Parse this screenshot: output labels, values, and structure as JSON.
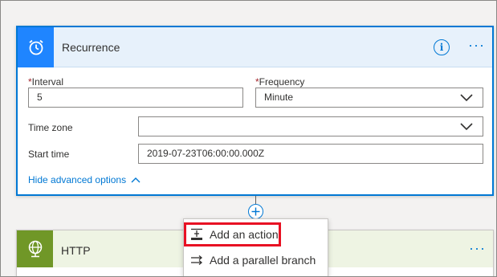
{
  "recurrence": {
    "title": "Recurrence",
    "info_icon": "info-icon",
    "more_label": "···",
    "interval": {
      "label": "Interval",
      "required_mark": "*",
      "value": "5"
    },
    "frequency": {
      "label": "Frequency",
      "required_mark": "*",
      "value": "Minute"
    },
    "time_zone": {
      "label": "Time zone",
      "value": ""
    },
    "start_time": {
      "label": "Start time",
      "value": "2019-07-23T06:00:00.000Z"
    },
    "hide_advanced": "Hide advanced options"
  },
  "http": {
    "title": "HTTP",
    "more_label": "···"
  },
  "menu": {
    "items": [
      {
        "label": "Add an action",
        "icon": "add-action-icon"
      },
      {
        "label": "Add a parallel branch",
        "icon": "parallel-branch-icon"
      }
    ]
  },
  "colors": {
    "accent": "#0078d4",
    "recurrence_icon_bg": "#1f85ff",
    "http_icon_bg": "#709727",
    "highlight": "#e81123"
  }
}
